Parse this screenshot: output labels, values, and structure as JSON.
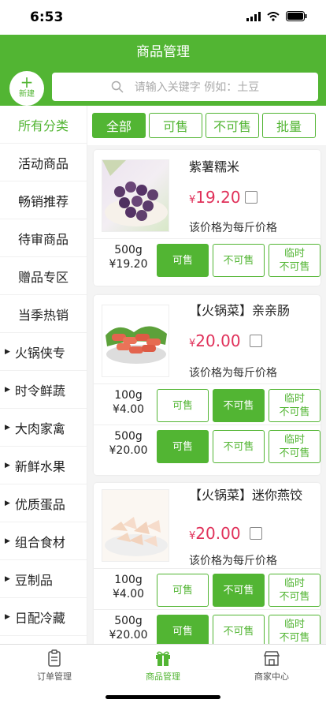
{
  "status": {
    "time": "6:53"
  },
  "header": {
    "title": "商品管理"
  },
  "toolbar": {
    "new_plus": "+",
    "new_label": "新建",
    "search_placeholder": "请输入关键字 例如：土豆"
  },
  "sidebar": {
    "items": [
      {
        "label": "所有分类"
      },
      {
        "label": "活动商品"
      },
      {
        "label": "畅销推荐"
      },
      {
        "label": "待审商品"
      },
      {
        "label": "赠品专区"
      },
      {
        "label": "当季热销"
      },
      {
        "label": "火锅侠专"
      },
      {
        "label": "时令鲜蔬"
      },
      {
        "label": "大肉家禽"
      },
      {
        "label": "新鲜水果"
      },
      {
        "label": "优质蛋品"
      },
      {
        "label": "组合食材"
      },
      {
        "label": "豆制品"
      },
      {
        "label": "日配冷藏"
      }
    ]
  },
  "filter_tabs": [
    "全部",
    "可售",
    "不可售",
    "批量"
  ],
  "products": [
    {
      "name": "紫薯糯米",
      "currency": "¥",
      "price": "19.20",
      "note": "该价格为每斤价格",
      "specs": [
        {
          "weight": "500g",
          "price": "¥19.20",
          "state": "可售"
        }
      ]
    },
    {
      "name": "【火锅菜】亲亲肠",
      "currency": "¥",
      "price": "20.00",
      "note": "该价格为每斤价格",
      "specs": [
        {
          "weight": "100g",
          "price": "¥4.00",
          "state": "不可售"
        },
        {
          "weight": "500g",
          "price": "¥20.00",
          "state": "可售"
        }
      ]
    },
    {
      "name": "【火锅菜】迷你燕饺",
      "currency": "¥",
      "price": "20.00",
      "note": "该价格为每斤价格",
      "specs": [
        {
          "weight": "100g",
          "price": "¥4.00",
          "state": "不可售"
        },
        {
          "weight": "500g",
          "price": "¥20.00",
          "state": "可售"
        }
      ]
    }
  ],
  "spec_buttons": {
    "sell": "可售",
    "unsell": "不可售",
    "temp_line1": "临时",
    "temp_line2": "不可售"
  },
  "tabbar": {
    "items": [
      {
        "label": "订单管理"
      },
      {
        "label": "商品管理"
      },
      {
        "label": "商家中心"
      }
    ]
  },
  "colors": {
    "accent": "#52b533",
    "price": "#e0315a"
  }
}
